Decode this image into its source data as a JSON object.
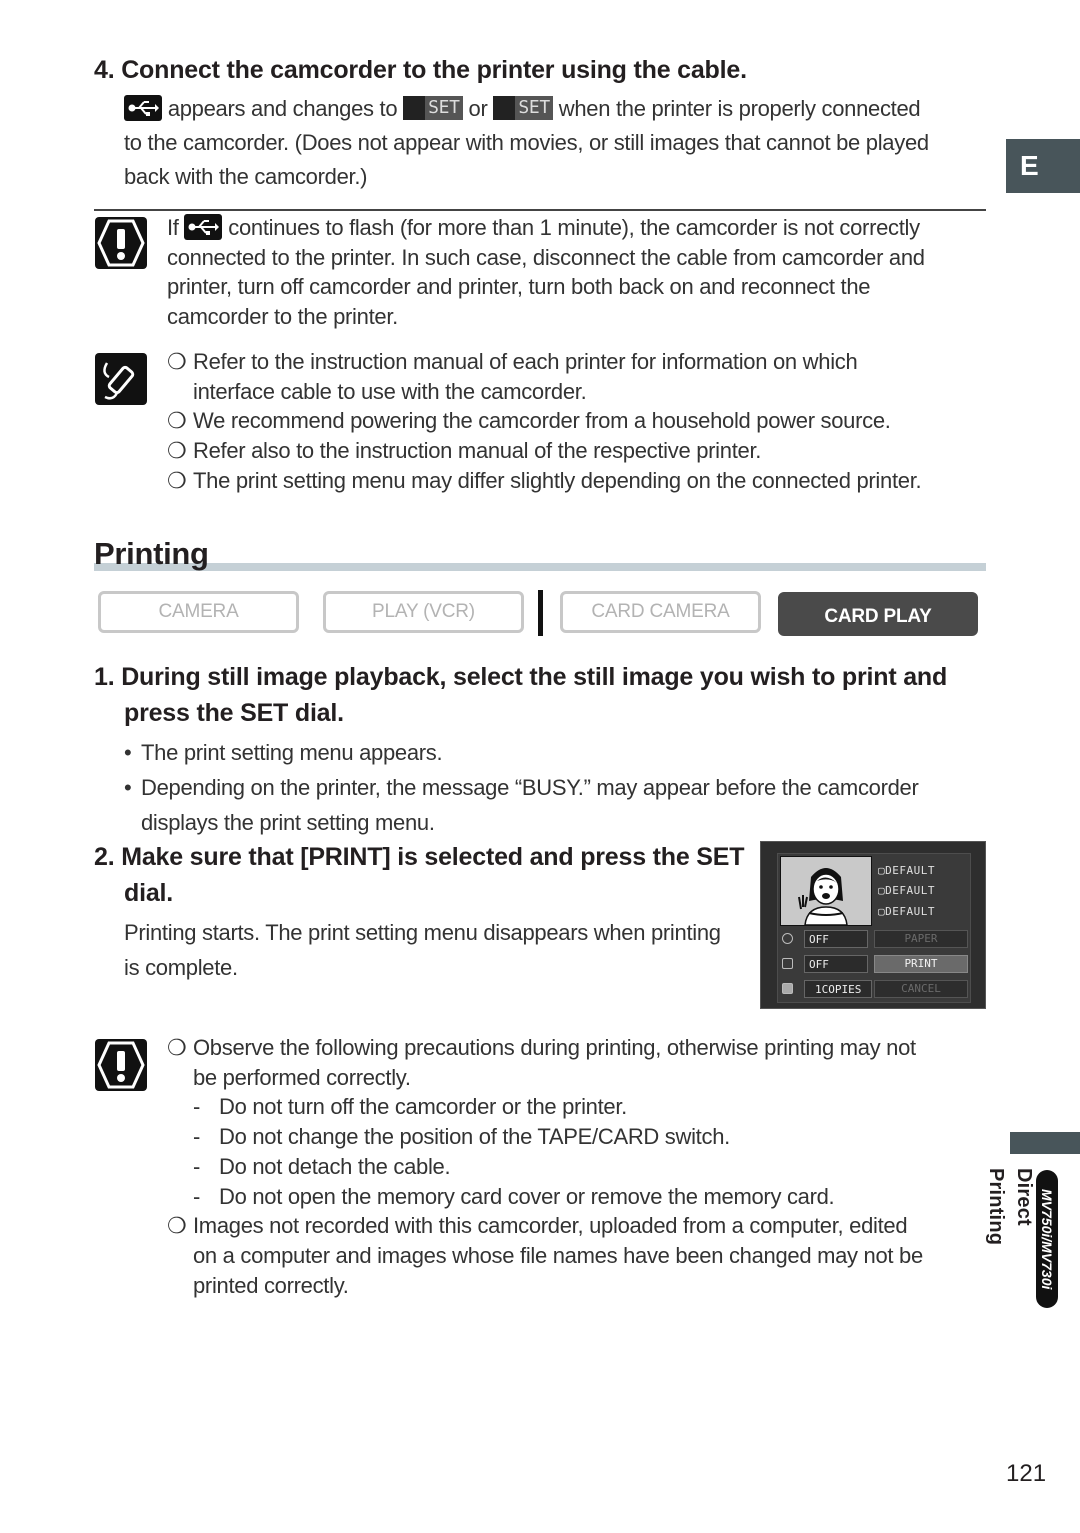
{
  "step4": {
    "heading": "4. Connect the camcorder to the printer using the cable.",
    "icons": [
      "usb-connection-icon",
      "print-set-icon",
      "direct-print-set-icon"
    ],
    "line1_a": "appears and changes to",
    "line1_or": "or",
    "line1_b": "when the printer is properly connected",
    "line2": "to the camcorder. (Does not appear with movies, or still images that cannot be played",
    "line3": "back with the camcorder.)",
    "set_label": "SET"
  },
  "caution1": {
    "prefix": "If",
    "line1": "continues to flash (for more than 1 minute), the camcorder is not correctly",
    "line2": "connected to the printer. In such case, disconnect the cable from camcorder and",
    "line3": "printer, turn off camcorder and printer, turn both back on and reconnect the",
    "line4": "camcorder to the printer."
  },
  "notes": {
    "mark": "❍",
    "items": [
      {
        "l1": "Refer to the instruction manual of each printer for information on which",
        "l2": "interface cable to use with the camcorder."
      },
      {
        "l1": "We recommend powering the camcorder from a household power source."
      },
      {
        "l1": "Refer also to the instruction manual of the respective printer."
      },
      {
        "l1": "The print setting menu may differ slightly depending on the connected printer."
      }
    ]
  },
  "section": {
    "title": "Printing",
    "modes": [
      {
        "label": "CAMERA",
        "active": false
      },
      {
        "label": "PLAY (VCR)",
        "active": false
      },
      {
        "label": "CARD CAMERA",
        "active": false
      },
      {
        "label": "CARD PLAY",
        "active": true
      }
    ]
  },
  "step1": {
    "heading_l1": "1. During still image playback, select the still image you wish to print and",
    "heading_l2": "press the SET dial.",
    "bullet": "•",
    "b1": "The print setting menu appears.",
    "b2_l1": "Depending on the printer, the message “BUSY.” may appear before the camcorder",
    "b2_l2": "displays the print setting menu."
  },
  "step2": {
    "heading_l1": "2. Make sure that [PRINT] is selected and press the SET",
    "heading_l2": "dial.",
    "body_l1": "Printing starts. The print setting menu disappears when printing",
    "body_l2": "is complete."
  },
  "lcd": {
    "defaults": [
      "DEFAULT",
      "DEFAULT",
      "DEFAULT"
    ],
    "rows": [
      {
        "icon": "timer-icon",
        "value": "OFF",
        "button": "PAPER",
        "selected": false
      },
      {
        "icon": "border-icon",
        "value": "OFF",
        "button": "PRINT",
        "selected": true
      },
      {
        "icon": "copies-icon",
        "value": "1",
        "unit": "COPIES",
        "button": "CANCEL",
        "selected": false
      }
    ]
  },
  "caution2": {
    "mark": "❍",
    "dash": "-",
    "intro_l1": "Observe the following precautions during printing, otherwise printing may not",
    "intro_l2": "be performed correctly.",
    "dashes": [
      "Do not turn off the camcorder or the printer.",
      "Do not change the position of the TAPE/CARD switch.",
      "Do not detach the cable.",
      "Do not open the memory card cover or remove the memory card."
    ],
    "last_l1": "Images not recorded with this camcorder, uploaded from a computer, edited",
    "last_l2": "on a computer and images whose file names have been changed may not be",
    "last_l3": "printed correctly."
  },
  "sidebar": {
    "language_tab": "E",
    "chapter": "Direct Printing",
    "model": "MV750i/MV730i"
  },
  "page_number": "121"
}
